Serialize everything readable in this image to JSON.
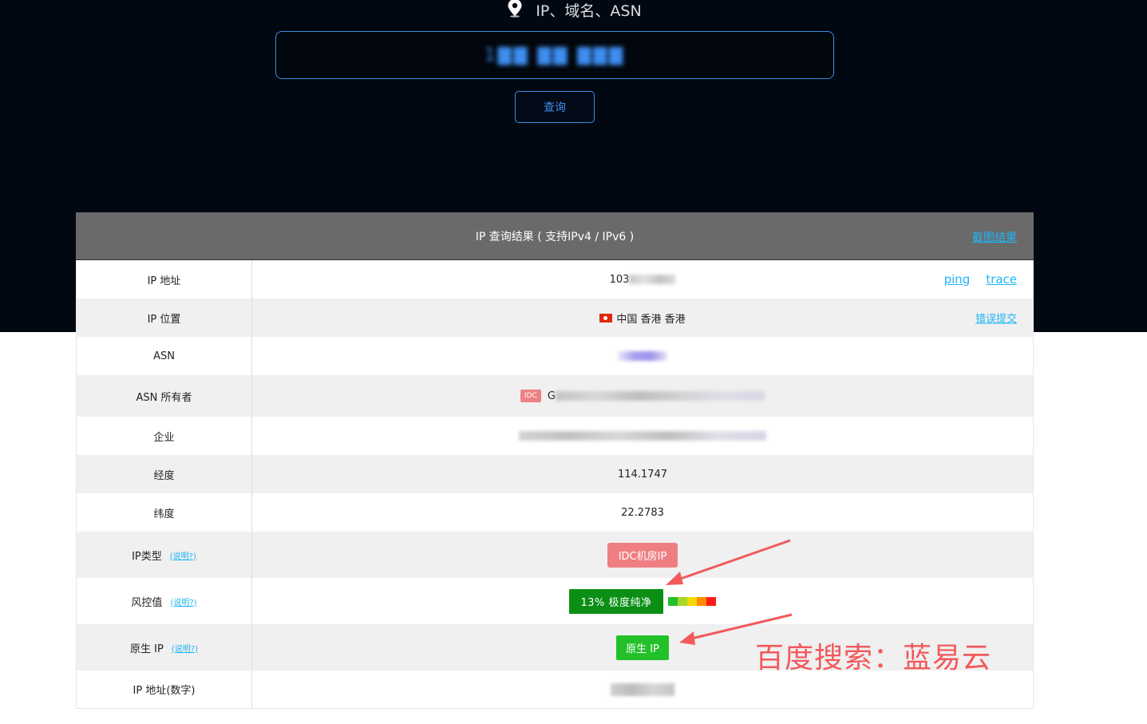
{
  "search": {
    "title": "IP、域名、ASN",
    "value": "1▇▇ ▇▇ ▇▇▇",
    "button_label": "查询"
  },
  "results": {
    "header_title": "IP 查询结果 ( 支持IPv4 / IPv6 )",
    "screenshot_link": "截图结果",
    "rows": {
      "ip": {
        "label": "IP 地址",
        "value": "103",
        "links": [
          "ping",
          "trace"
        ]
      },
      "location": {
        "label": "IP 位置",
        "value": "中国 香港 香港",
        "report_link": "错误提交"
      },
      "asn": {
        "label": "ASN"
      },
      "asn_owner": {
        "label": "ASN 所有者",
        "tag": "IDC",
        "value": "G"
      },
      "company": {
        "label": "企业"
      },
      "longitude": {
        "label": "经度",
        "value": "114.1747"
      },
      "latitude": {
        "label": "纬度",
        "value": "22.2783"
      },
      "ip_type": {
        "label": "IP类型",
        "help": "(说明?)",
        "badge": "IDC机房IP"
      },
      "risk": {
        "label": "风控值",
        "help": "(说明?)",
        "badge": "13%  极度纯净"
      },
      "native": {
        "label": "原生 IP",
        "help": "(说明?)",
        "badge": "原生 IP"
      },
      "ip_numeric": {
        "label": "IP 地址(数字)"
      }
    }
  },
  "watermark": "百度搜索：蓝易云",
  "colors": {
    "accent_blue": "#3b8fe0",
    "link_blue": "#20b5f6",
    "idc_red": "#ef7e82",
    "risk_green": "#0a8f14",
    "native_green": "#22c12a",
    "annotation_red": "#f2595b",
    "risk_scale": [
      "#22c12a",
      "#a6d72a",
      "#f5d800",
      "#ff8c00",
      "#ff1a1a"
    ]
  }
}
